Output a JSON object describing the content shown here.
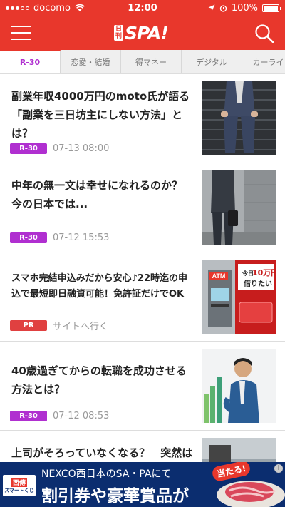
{
  "status_bar": {
    "carrier": "docomo",
    "time": "12:00",
    "battery": "100%",
    "battery_level": 1.0
  },
  "header": {
    "logo_small_top": "日",
    "logo_small_bottom": "刊",
    "logo_big": "SPA!",
    "menu_icon": "hamburger-icon",
    "search_icon": "search-icon"
  },
  "tabs": [
    {
      "label": "R-30",
      "active": true
    },
    {
      "label": "恋愛・結婚",
      "active": false
    },
    {
      "label": "得マネー",
      "active": false
    },
    {
      "label": "デジタル",
      "active": false
    },
    {
      "label": "カーライフ",
      "active": false
    }
  ],
  "articles": [
    {
      "title": "副業年収4000万円のmoto氏が語る「副業を三日坊主にしない方法」とは？",
      "badge": "R-30",
      "date": "07-13 08:00"
    },
    {
      "title": "中年の無一文は幸せになれるのか？ 今の日本では...",
      "badge": "R-30",
      "date": "07-12 15:53"
    },
    {
      "title": "スマホ完結申込みだから安心♪22時迄の申込で最短即日融資可能！免許証だけでOK",
      "badge": "PR",
      "date": "サイトへ行く",
      "thumb_text": {
        "atm": "ATM",
        "today": "今日",
        "amount": "10万円",
        "want": "借りたい"
      }
    },
    {
      "title": "40歳過ぎてからの転職を成功させる方法とは？",
      "badge": "R-30",
      "date": "07-12 08:53"
    },
    {
      "title": "上司がそろっていなくなる？　突然は",
      "badge": "",
      "date": ""
    }
  ],
  "banner": {
    "brand_top": "西傳",
    "brand_bottom": "スマートくじ",
    "line1": "NEXCO西日本のSA・PAにて",
    "line2": "割引券や豪華賞品が",
    "hit": "当たる!",
    "info": "i"
  },
  "colors": {
    "brand_red": "#e8372c",
    "r30_purple": "#b02fd0",
    "pr_red": "#e04040",
    "banner_navy": "#0b2d6f"
  }
}
